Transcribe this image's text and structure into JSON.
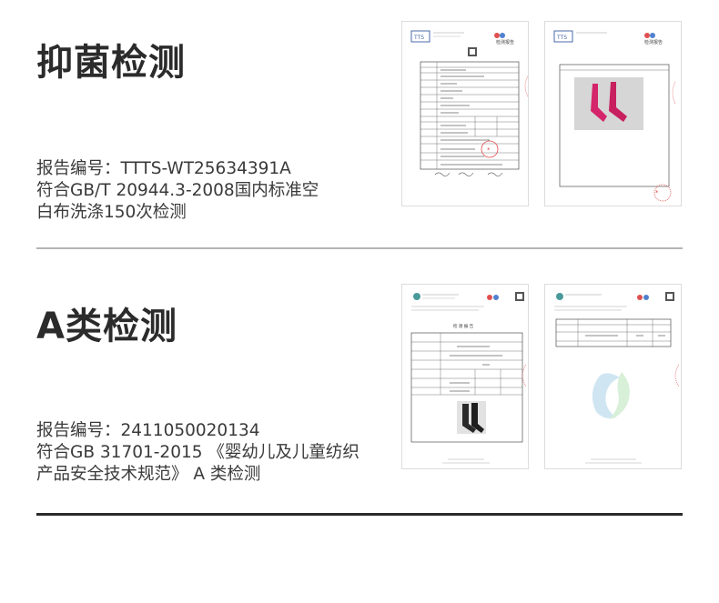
{
  "sections": [
    {
      "title": "抑菌检测",
      "lines": [
        "报告编号：TTTS-WT25634391A",
        "符合GB/T 20944.3-2008国内标准空",
        "白布洗涤150次检测"
      ],
      "report_header": "检测报告"
    },
    {
      "title": "A类检测",
      "lines": [
        "报告编号：2411050020134",
        "符合GB 31701-2015 《婴幼儿及儿童纺织",
        "产品安全技术规范》 A 类检测"
      ],
      "report_header": "检 测 报 告"
    }
  ],
  "colors": {
    "divider_light": "#b5b5b5",
    "divider_dark": "#2a2a2a",
    "sock_pink": "#d4246a",
    "sock_black": "#2a2a2a",
    "stamp_red": "#e04848"
  }
}
